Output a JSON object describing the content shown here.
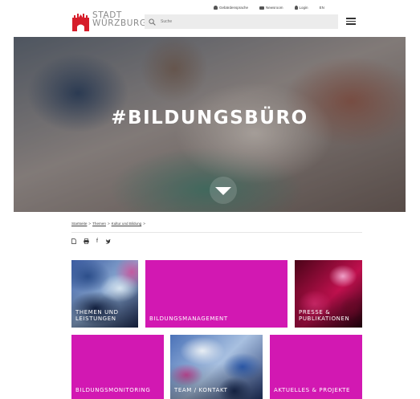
{
  "header": {
    "util_links": [
      {
        "label": "Gebärdensprache",
        "icon": "sign-language-icon"
      },
      {
        "label": "Newsroom",
        "icon": "newsroom-icon"
      },
      {
        "label": "Login",
        "icon": "user-icon"
      },
      {
        "label": "EN",
        "icon": ""
      }
    ],
    "logo": {
      "line1": "STADT",
      "line2": "WÜRZBURG",
      "color": "#d61e2b"
    },
    "search": {
      "placeholder": "Suche"
    },
    "menu_icon": "hamburger-menu-icon"
  },
  "hero": {
    "title": "#BILDUNGSBÜRO",
    "arrow_icon": "chevron-down-icon"
  },
  "breadcrumb": [
    {
      "label": "Startseite"
    },
    {
      "label": "Themen"
    },
    {
      "label": "Kultur und Bildung"
    }
  ],
  "share_icons": [
    "pdf-icon",
    "print-icon",
    "facebook-icon",
    "twitter-icon"
  ],
  "tiles": [
    {
      "label": "THEMEN UND LEISTUNGEN",
      "line1": "THEMEN UND",
      "line2": "LEISTUNGEN",
      "style": "image-blue"
    },
    {
      "label": "BILDUNGSMANAGEMENT",
      "style": "magenta"
    },
    {
      "label": "PRESSE & PUBLIKATIONEN",
      "line1": "PRESSE &",
      "line2": "PUBLIKATIONEN",
      "style": "image-red"
    },
    {
      "label": "BILDUNGSMONITORING",
      "style": "magenta"
    },
    {
      "label": "TEAM / KONTAKT",
      "style": "image-blue"
    },
    {
      "label": "AKTUELLES & PROJEKTE",
      "style": "magenta"
    }
  ],
  "colors": {
    "accent": "#d218b2",
    "logo_red": "#d61e2b"
  }
}
